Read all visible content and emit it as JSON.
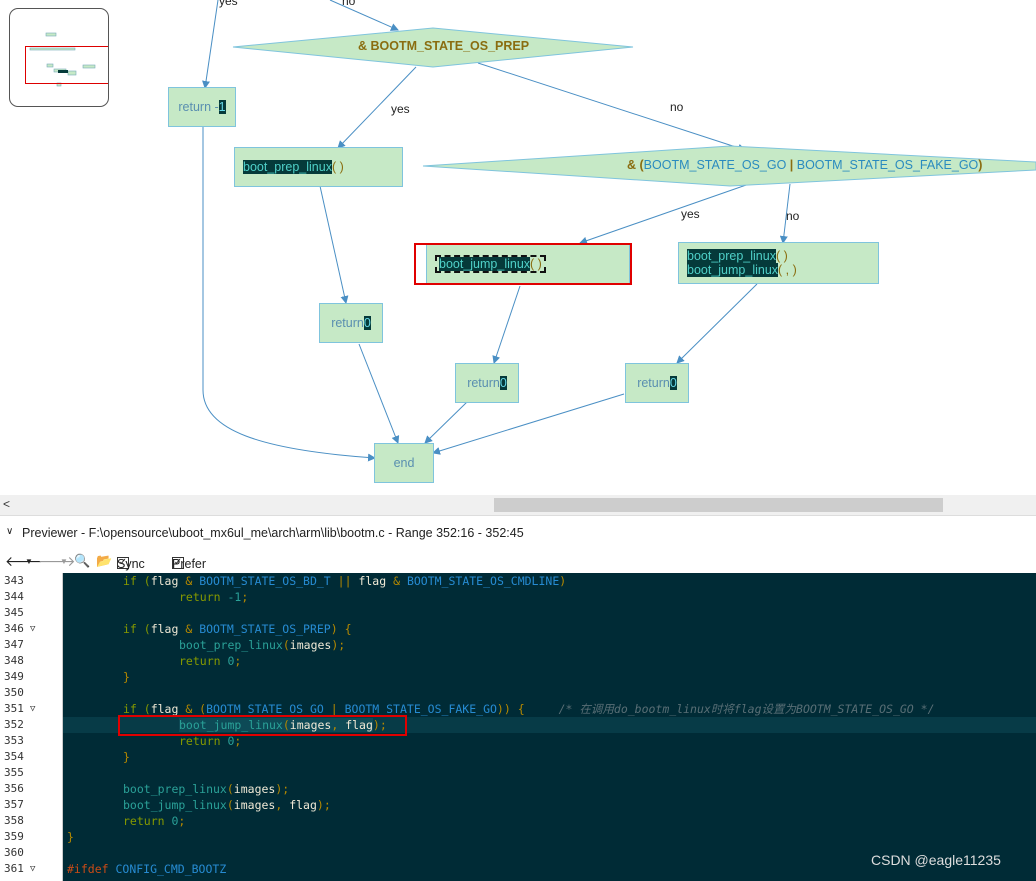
{
  "flowchart": {
    "edge_labels": {
      "yes_top": "yes",
      "no_top": "no",
      "yes_prep": "yes",
      "no_prep": "no",
      "yes_go": "yes",
      "no_go": "no"
    },
    "decision_prep": {
      "text": "& BOOTM_STATE_OS_PREP"
    },
    "decision_go": {
      "amp": "& (",
      "c1": "BOOTM_STATE_OS_GO",
      "sep": " | ",
      "c2": "BOOTM_STATE_OS_FAKE_GO",
      "close": ")"
    },
    "return_minus1": {
      "kw": "return -",
      "val": "1"
    },
    "boot_prep": {
      "fn": "boot_prep_linux",
      "rest": "(        )"
    },
    "boot_jump": {
      "fn": "boot_jump_linux",
      "rest": "(            )"
    },
    "combo": {
      "fn1": "boot_prep_linux",
      "rest1": "(         )",
      "fn2": "boot_jump_linux",
      "rest2": "(          ,     )"
    },
    "return0_a": {
      "kw": "return ",
      "val": "0"
    },
    "return0_b": {
      "kw": "return ",
      "val": "0"
    },
    "return0_c": {
      "kw": "return ",
      "val": "0"
    },
    "end": "end"
  },
  "previewer": {
    "title": "Previewer - F:\\opensource\\uboot_mx6ul_me\\arch\\arm\\lib\\bootm.c - Range 352:16 - 352:45",
    "sync_label": "Sync",
    "prefer_label": "Prefer"
  },
  "code_lines": [
    {
      "n": "343",
      "fold": ""
    },
    {
      "n": "344",
      "fold": ""
    },
    {
      "n": "345",
      "fold": ""
    },
    {
      "n": "346",
      "fold": "▽"
    },
    {
      "n": "347",
      "fold": ""
    },
    {
      "n": "348",
      "fold": ""
    },
    {
      "n": "349",
      "fold": ""
    },
    {
      "n": "350",
      "fold": ""
    },
    {
      "n": "351",
      "fold": "▽"
    },
    {
      "n": "352",
      "fold": ""
    },
    {
      "n": "353",
      "fold": ""
    },
    {
      "n": "354",
      "fold": ""
    },
    {
      "n": "355",
      "fold": ""
    },
    {
      "n": "356",
      "fold": ""
    },
    {
      "n": "357",
      "fold": ""
    },
    {
      "n": "358",
      "fold": ""
    },
    {
      "n": "359",
      "fold": ""
    },
    {
      "n": "360",
      "fold": ""
    },
    {
      "n": "361",
      "fold": "▽"
    }
  ],
  "code": {
    "l343": [
      "if (",
      "flag",
      " & ",
      "BOOTM_STATE_OS_BD_T",
      " || ",
      "flag",
      " & ",
      "BOOTM_STATE_OS_CMDLINE",
      ")"
    ],
    "l344": [
      "return ",
      "-1",
      ";"
    ],
    "l346": [
      "if (",
      "flag",
      " & ",
      "BOOTM_STATE_OS_PREP",
      ") {"
    ],
    "l347": [
      "boot_prep_linux",
      "(",
      "images",
      ");"
    ],
    "l348": [
      "return ",
      "0",
      ";"
    ],
    "l349": [
      "}"
    ],
    "l351": [
      "if (",
      "flag",
      " & (",
      "BOOTM_STATE_OS_GO",
      " | ",
      "BOOTM_STATE_OS_FAKE_GO",
      ")) {",
      "/* 在调用do_bootm_linux时将flag设置为BOOTM_STATE_OS_GO */"
    ],
    "l352": [
      "boot_jump_linux",
      "(",
      "images",
      ", ",
      "flag",
      ");"
    ],
    "l353": [
      "return ",
      "0",
      ";"
    ],
    "l354": [
      "}"
    ],
    "l356": [
      "boot_prep_linux",
      "(",
      "images",
      ");"
    ],
    "l357": [
      "boot_jump_linux",
      "(",
      "images",
      ", ",
      "flag",
      ");"
    ],
    "l358": [
      "return ",
      "0",
      ";"
    ],
    "l359": [
      "}"
    ],
    "l361": [
      "#ifdef ",
      "CONFIG_CMD_BOOTZ"
    ]
  },
  "watermark": "CSDN @eagle11235",
  "colors": {
    "highlight_box": "#e00000",
    "node_fill": "#c6e9c6",
    "editor_bg": "#002b36"
  }
}
